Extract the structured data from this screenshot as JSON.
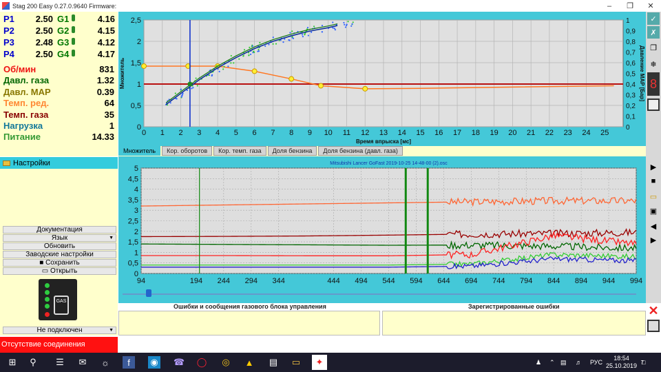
{
  "window": {
    "title": "Stag 200 Easy 0.27.0.9640 Firmware:"
  },
  "injectors": [
    {
      "p": "P1",
      "pv": "2.50",
      "g": "G1",
      "gv": "4.16"
    },
    {
      "p": "P2",
      "pv": "2.50",
      "g": "G2",
      "gv": "4.15"
    },
    {
      "p": "P3",
      "pv": "2.48",
      "g": "G3",
      "gv": "4.12"
    },
    {
      "p": "P4",
      "pv": "2.50",
      "g": "G4",
      "gv": "4.17"
    }
  ],
  "params": [
    {
      "label": "Об/мин",
      "value": "831",
      "color": "#ee1111"
    },
    {
      "label": "Давл. газа",
      "value": "1.32",
      "color": "#006600"
    },
    {
      "label": "Давл. MAP",
      "value": "0.39",
      "color": "#887700"
    },
    {
      "label": "Темп. ред.",
      "value": "64",
      "color": "#ff8833"
    },
    {
      "label": "Темп. газа",
      "value": "35",
      "color": "#880000"
    },
    {
      "label": "Нагрузка",
      "value": "1",
      "color": "#117799"
    },
    {
      "label": "Питание",
      "value": "14.33",
      "color": "#339933"
    }
  ],
  "settings": {
    "title": "Настройки"
  },
  "menu": {
    "documentation": "Документация",
    "language": "Язык",
    "refresh": "Обновить",
    "factory": "Заводские настройки",
    "save": "Сохранить",
    "open": "Открыть",
    "connection": "Не подключен"
  },
  "gas_switch": {
    "label": "GAS"
  },
  "status": {
    "text": "Отсутствие соединения"
  },
  "tabs": [
    "Множитель",
    "Кор. оборотов",
    "Кор. темп. газа",
    "Доля бензина",
    "Доля бензина (давл. газа)"
  ],
  "errors": {
    "left_title": "Ошибки и сообщения газового блока управления",
    "right_title": "Зарегистрированные ошибки"
  },
  "chart_data": [
    {
      "type": "scatter",
      "title": "",
      "xlabel": "Время впрыска [мс]",
      "ylabel": "Множитель",
      "y2label": "Давление MAP [Бар]",
      "xlim": [
        0,
        26
      ],
      "ylim": [
        0,
        2.5
      ],
      "y2lim": [
        0,
        1
      ],
      "xticks": [
        "0",
        "1",
        "2",
        "3",
        "4",
        "5",
        "6",
        "7",
        "8",
        "9",
        "10",
        "11",
        "12",
        "13",
        "14",
        "15",
        "16",
        "17",
        "18",
        "19",
        "20",
        "21",
        "22",
        "23",
        "24",
        "25"
      ],
      "yticks": [
        "0",
        "0,5",
        "1",
        "1,5",
        "2",
        "2,5"
      ],
      "y2ticks": [
        "0",
        "0,1",
        "0,2",
        "0,3",
        "0,4",
        "0,5",
        "0,6",
        "0,7",
        "0,8",
        "0,9",
        "1"
      ],
      "cursor_x": 2.5,
      "reference_y": 1.0,
      "multiplier_curve": {
        "x": [
          1.2,
          2,
          3,
          4,
          5,
          6,
          7,
          8,
          9,
          10,
          10.5
        ],
        "y": [
          0.52,
          0.78,
          1.1,
          1.38,
          1.62,
          1.83,
          2.0,
          2.13,
          2.24,
          2.32,
          2.37
        ]
      },
      "pressure_curve": {
        "x": [
          0,
          2.4,
          4,
          6,
          8,
          9.6,
          12,
          15,
          20,
          25.5
        ],
        "y": [
          1.42,
          1.42,
          1.42,
          1.3,
          1.12,
          0.96,
          0.89,
          0.9,
          0.93,
          0.96
        ]
      }
    },
    {
      "type": "line",
      "title": "Mitsubishi Lancer GoFast 2019-10-25 14-48-00 (2).osc",
      "xlim": [
        94,
        994
      ],
      "ylim": [
        0,
        5
      ],
      "xticks": [
        "94",
        "194",
        "244",
        "294",
        "344",
        "444",
        "494",
        "544",
        "594",
        "644",
        "694",
        "744",
        "794",
        "844",
        "894",
        "944",
        "994"
      ],
      "yticks": [
        "0",
        "0,5",
        "1",
        "1,5",
        "2",
        "2,5",
        "3",
        "3,5",
        "4",
        "4,5",
        "5"
      ],
      "markers_x": [
        200,
        575,
        615
      ],
      "series": [
        {
          "color": "#ff6633",
          "values": [
            3.2,
            3.25,
            3.3,
            3.35,
            3.4,
            3.45,
            3.45
          ]
        },
        {
          "color": "#990000",
          "values": [
            1.75,
            1.76,
            1.78,
            1.82,
            1.87,
            1.9,
            1.95
          ]
        },
        {
          "color": "#006600",
          "values": [
            1.4,
            1.38,
            1.36,
            1.34,
            1.35,
            1.3,
            1.2
          ]
        },
        {
          "color": "#ff2222",
          "values": [
            0.85,
            0.85,
            0.84,
            0.84,
            0.9,
            1.8,
            1.4
          ]
        },
        {
          "color": "#33cc33",
          "values": [
            0.4,
            0.4,
            0.4,
            0.4,
            0.45,
            0.9,
            0.8
          ]
        },
        {
          "color": "#2222cc",
          "values": [
            0.3,
            0.3,
            0.3,
            0.3,
            0.35,
            0.7,
            0.6
          ]
        }
      ]
    }
  ],
  "taskbar": {
    "lang": "РУС",
    "time": "18:54",
    "date": "25.10.2019",
    "notif": "7"
  }
}
